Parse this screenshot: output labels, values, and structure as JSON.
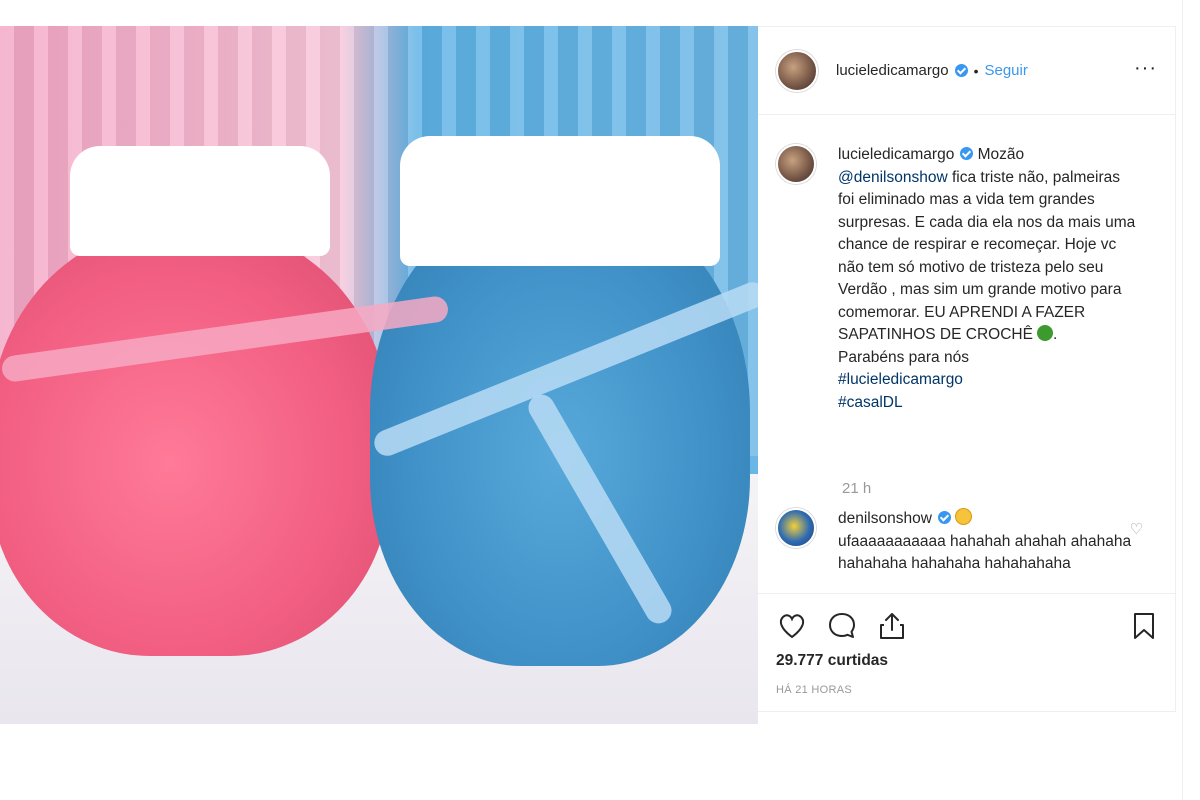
{
  "post": {
    "author": "lucieledicamargo",
    "follow_label": "Seguir",
    "separator": "•",
    "more_label": "···"
  },
  "caption": {
    "username": "lucieledicamargo",
    "intro": "Mozão",
    "mention": "@denilsonshow",
    "body": "fica triste não, palmeiras foi eliminado mas a vida tem grandes surpresas. E cada dia ela nos da mais uma chance de respirar e recomeçar. Hoje vc não tem só motivo de tristeza pelo seu Verdão , mas sim um grande motivo para comemorar. EU APRENDI A FAZER SAPATINHOS DE CROCHÊ",
    "body_tail": ".",
    "thanks": "Parabéns para nós",
    "hashtag1": "#lucieledicamargo",
    "hashtag2": "#casalDL",
    "time": "21 h"
  },
  "reply": {
    "username": "denilsonshow",
    "text": "ufaaaaaaaaaaa hahahah ahahah ahahaha hahahaha hahahaha hahahahaha"
  },
  "stats": {
    "likes_count": "29.777",
    "likes_word": "curtidas",
    "posted_ago": "HÁ 21 HORAS"
  },
  "icons": [
    "heart-icon",
    "comment-icon",
    "share-icon",
    "bookmark-icon"
  ]
}
